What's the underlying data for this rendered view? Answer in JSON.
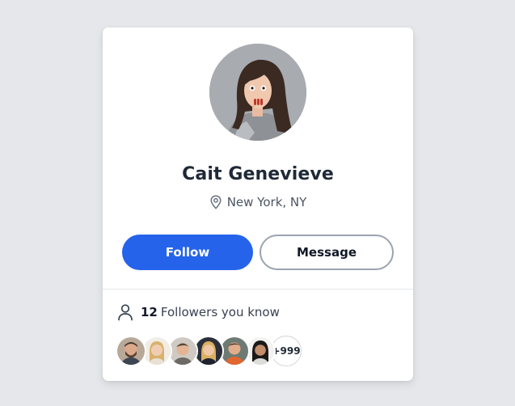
{
  "profile": {
    "name": "Cait Genevieve",
    "location": "New York, NY"
  },
  "actions": {
    "follow_label": "Follow",
    "message_label": "Message"
  },
  "followers": {
    "count": "12",
    "label": "Followers you know",
    "more_label": "+999"
  },
  "colors": {
    "background": "#e5e7eb",
    "card": "#ffffff",
    "primary": "#2563eb",
    "text": "#1f2937"
  }
}
